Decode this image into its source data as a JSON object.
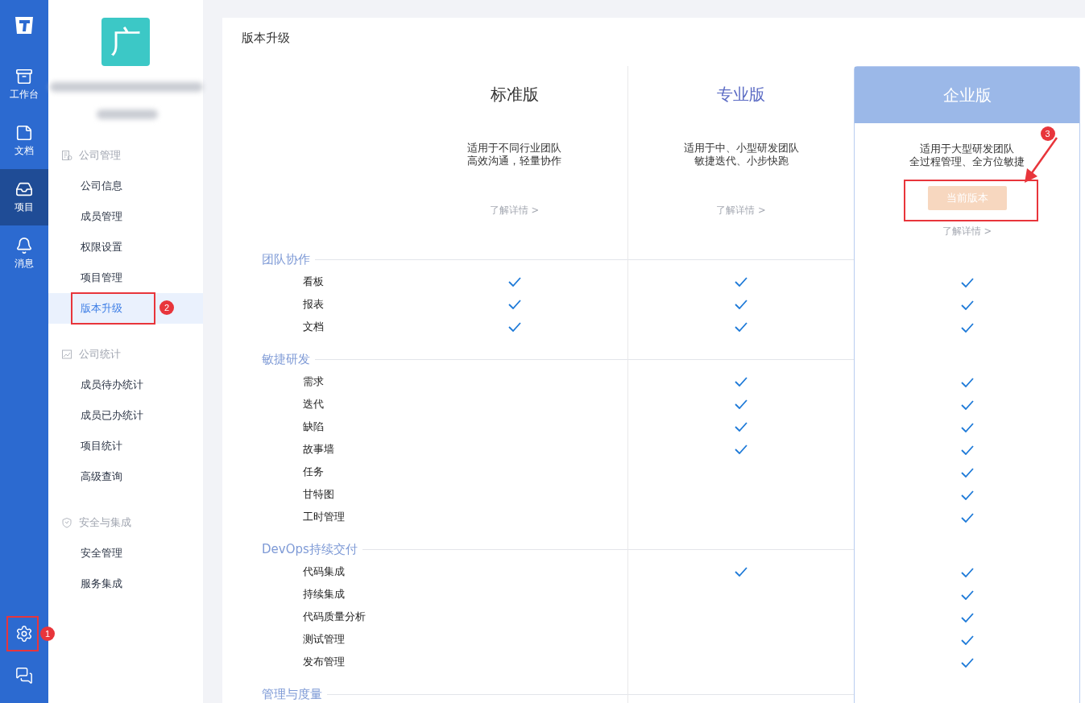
{
  "rail": {
    "items": [
      {
        "label": "工作台",
        "selected": false
      },
      {
        "label": "文档",
        "selected": false
      },
      {
        "label": "项目",
        "selected": true
      },
      {
        "label": "消息",
        "selected": false
      }
    ],
    "settings_annotation": "1"
  },
  "sidebar": {
    "logo_text": "广",
    "groups": [
      {
        "title": "公司管理",
        "items": [
          {
            "label": "公司信息",
            "selected": false
          },
          {
            "label": "成员管理",
            "selected": false
          },
          {
            "label": "权限设置",
            "selected": false
          },
          {
            "label": "项目管理",
            "selected": false
          },
          {
            "label": "版本升级",
            "selected": true,
            "annotation": "2"
          }
        ]
      },
      {
        "title": "公司统计",
        "items": [
          {
            "label": "成员待办统计",
            "selected": false
          },
          {
            "label": "成员已办统计",
            "selected": false
          },
          {
            "label": "项目统计",
            "selected": false
          },
          {
            "label": "高级查询",
            "selected": false
          }
        ]
      },
      {
        "title": "安全与集成",
        "items": [
          {
            "label": "安全管理",
            "selected": false
          },
          {
            "label": "服务集成",
            "selected": false
          }
        ]
      }
    ]
  },
  "page_title": "版本升级",
  "plans": [
    {
      "name": "标准版",
      "description": [
        "适用于不同行业团队",
        "高效沟通，轻量协作"
      ],
      "link": "了解详情 >",
      "current": false,
      "hovered": false
    },
    {
      "name": "专业版",
      "description": [
        "适用于中、小型研发团队",
        "敏捷迭代、小步快跑"
      ],
      "link": "了解详情 >",
      "current": false,
      "hovered": true
    },
    {
      "name": "企业版",
      "description": [
        "适用于大型研发团队",
        "全过程管理、全方位敏捷"
      ],
      "button": "当前版本",
      "link": "了解详情 >",
      "current": true,
      "hovered": false,
      "annotation": "3"
    }
  ],
  "feature_groups": [
    {
      "name": "团队协作",
      "features": [
        {
          "name": "看板",
          "included": [
            true,
            true,
            true
          ]
        },
        {
          "name": "报表",
          "included": [
            true,
            true,
            true
          ]
        },
        {
          "name": "文档",
          "included": [
            true,
            true,
            true
          ]
        }
      ]
    },
    {
      "name": "敏捷研发",
      "features": [
        {
          "name": "需求",
          "included": [
            false,
            true,
            true
          ]
        },
        {
          "name": "迭代",
          "included": [
            false,
            true,
            true
          ]
        },
        {
          "name": "缺陷",
          "included": [
            false,
            true,
            true
          ]
        },
        {
          "name": "故事墙",
          "included": [
            false,
            true,
            true
          ]
        },
        {
          "name": "任务",
          "included": [
            false,
            false,
            true
          ]
        },
        {
          "name": "甘特图",
          "included": [
            false,
            false,
            true
          ]
        },
        {
          "name": "工时管理",
          "included": [
            false,
            false,
            true
          ]
        }
      ]
    },
    {
      "name": "DevOps持续交付",
      "features": [
        {
          "name": "代码集成",
          "included": [
            false,
            true,
            true
          ]
        },
        {
          "name": "持续集成",
          "included": [
            false,
            false,
            true
          ]
        },
        {
          "name": "代码质量分析",
          "included": [
            false,
            false,
            true
          ]
        },
        {
          "name": "测试管理",
          "included": [
            false,
            false,
            true
          ]
        },
        {
          "name": "发布管理",
          "included": [
            false,
            false,
            true
          ]
        }
      ]
    },
    {
      "name": "管理与度量"
    }
  ]
}
